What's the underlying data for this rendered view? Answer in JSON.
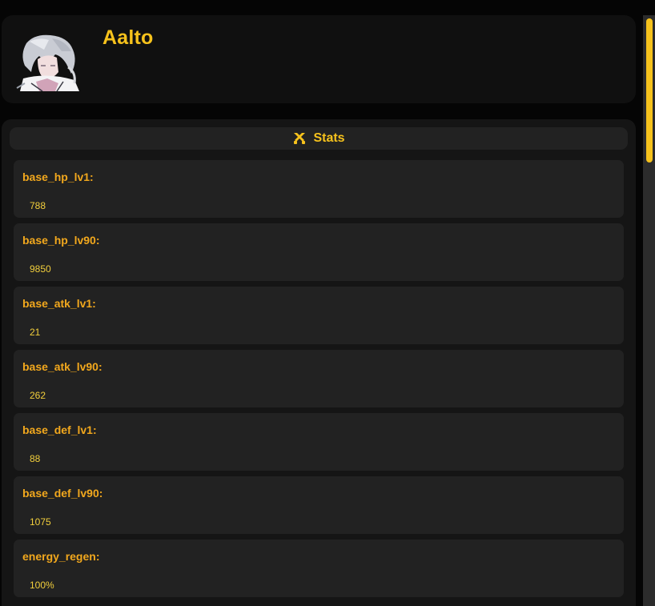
{
  "character": {
    "name": "Aalto",
    "avatar_icon": "character-portrait"
  },
  "stats": {
    "title": "Stats",
    "icon": "crossed-swords-icon",
    "items": [
      {
        "label": "base_hp_lv1:",
        "value": "788"
      },
      {
        "label": "base_hp_lv90:",
        "value": "9850"
      },
      {
        "label": "base_atk_lv1:",
        "value": "21"
      },
      {
        "label": "base_atk_lv90:",
        "value": "262"
      },
      {
        "label": "base_def_lv1:",
        "value": "88"
      },
      {
        "label": "base_def_lv90:",
        "value": "1075"
      },
      {
        "label": "energy_regen:",
        "value": "100%"
      }
    ]
  },
  "colors": {
    "accent": "#f6c21c",
    "label": "#f2a81d",
    "card": "#222222",
    "panel": "#151515"
  }
}
